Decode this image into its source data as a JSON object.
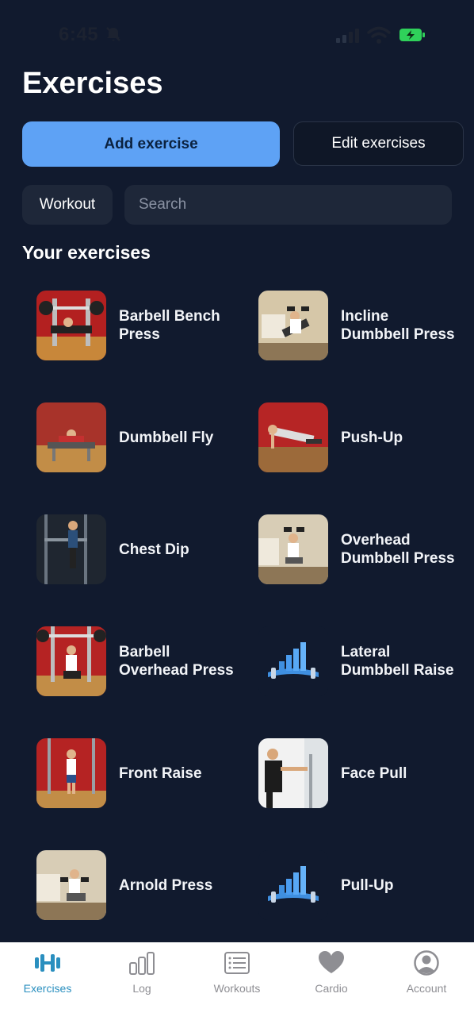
{
  "status_bar": {
    "time": "6:45"
  },
  "header": {
    "title": "Exercises"
  },
  "actions": {
    "add_label": "Add exercise",
    "edit_label": "Edit exercises"
  },
  "filters": {
    "chip_label": "Workout",
    "search_placeholder": "Search"
  },
  "section": {
    "title": "Your exercises"
  },
  "exercises": [
    {
      "name": "Barbell Bench Press",
      "icon": "barbell-bench-press-photo"
    },
    {
      "name": "Incline Dumbbell Press",
      "icon": "incline-dumbbell-press-photo"
    },
    {
      "name": "Dumbbell Fly",
      "icon": "dumbbell-fly-photo"
    },
    {
      "name": "Push-Up",
      "icon": "push-up-photo"
    },
    {
      "name": "Chest Dip",
      "icon": "chest-dip-photo"
    },
    {
      "name": "Overhead Dumbbell Press",
      "icon": "overhead-dumbbell-press-photo"
    },
    {
      "name": "Barbell Overhead Press",
      "icon": "barbell-overhead-press-photo"
    },
    {
      "name": "Lateral Dumbbell Raise",
      "icon": "app-logo-placeholder-icon"
    },
    {
      "name": "Front Raise",
      "icon": "front-raise-photo"
    },
    {
      "name": "Face Pull",
      "icon": "face-pull-photo"
    },
    {
      "name": "Arnold Press",
      "icon": "arnold-press-photo"
    },
    {
      "name": "Pull-Up",
      "icon": "app-logo-placeholder-icon"
    }
  ],
  "tab_bar": {
    "tabs": [
      {
        "label": "Exercises",
        "icon": "barbell-icon",
        "active": true
      },
      {
        "label": "Log",
        "icon": "bar-chart-icon",
        "active": false
      },
      {
        "label": "Workouts",
        "icon": "list-icon",
        "active": false
      },
      {
        "label": "Cardio",
        "icon": "heart-icon",
        "active": false
      },
      {
        "label": "Account",
        "icon": "person-circle-icon",
        "active": false
      }
    ]
  },
  "colors": {
    "background": "#111a2e",
    "accent": "#5ea2f5",
    "tab_active": "#2a8fbf",
    "tab_inactive": "#8e8e93"
  }
}
